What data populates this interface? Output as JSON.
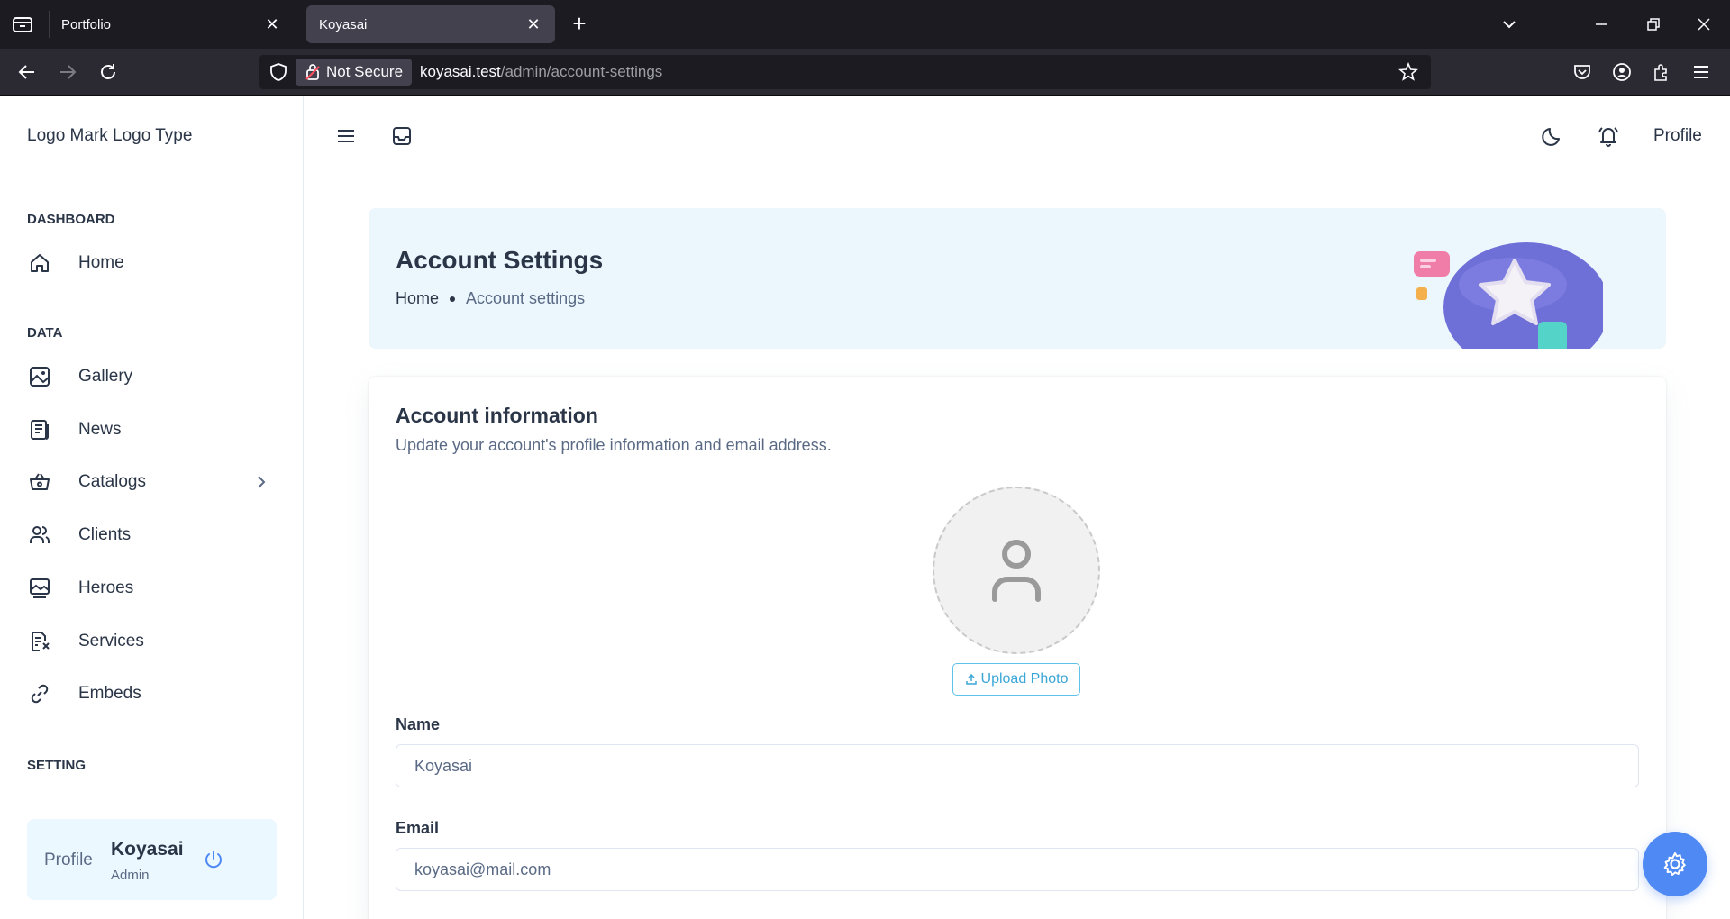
{
  "browser": {
    "tabs": [
      {
        "title": "Portfolio"
      },
      {
        "title": "Koyasai"
      }
    ],
    "security_label": "Not Secure",
    "url_host": "koyasai.test",
    "url_path": "/admin/account-settings"
  },
  "sidebar": {
    "logo": "Logo Mark Logo Type",
    "sections": {
      "dashboard": "DASHBOARD",
      "data": "DATA",
      "setting": "SETTING"
    },
    "items": [
      {
        "label": "Home",
        "icon": "home-icon"
      },
      {
        "label": "Gallery",
        "icon": "image-icon"
      },
      {
        "label": "News",
        "icon": "news-icon"
      },
      {
        "label": "Catalogs",
        "icon": "basket-icon"
      },
      {
        "label": "Clients",
        "icon": "users-icon"
      },
      {
        "label": "Heroes",
        "icon": "photo-icon"
      },
      {
        "label": "Services",
        "icon": "file-icon"
      },
      {
        "label": "Embeds",
        "icon": "link-icon"
      }
    ],
    "profile": {
      "label": "Profile",
      "name": "Koyasai",
      "role": "Admin"
    }
  },
  "header": {
    "profile_label": "Profile"
  },
  "banner": {
    "title": "Account Settings",
    "breadcrumb_home": "Home",
    "breadcrumb_current": "Account settings"
  },
  "account": {
    "title": "Account information",
    "subtitle": "Update your account's profile information and email address.",
    "upload_label": "Upload Photo",
    "name_label": "Name",
    "name_value": "Koyasai",
    "email_label": "Email",
    "email_value": "koyasai@mail.com"
  },
  "colors": {
    "accent": "#4f89f3",
    "banner_bg": "#ebf7fd",
    "upload_accent": "#3aa6d8"
  }
}
